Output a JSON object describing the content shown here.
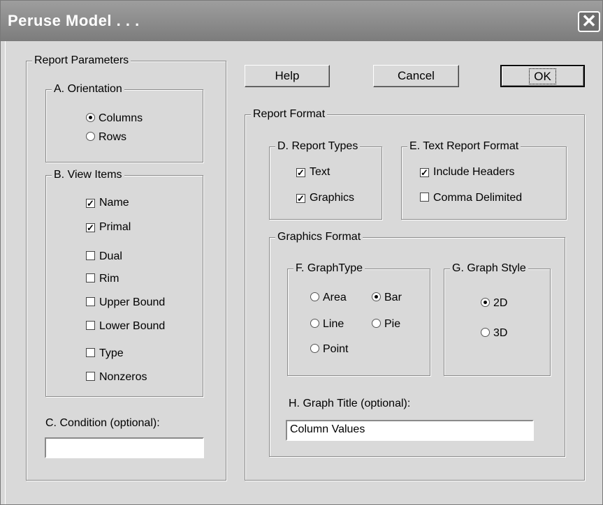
{
  "window": {
    "title": "Peruse Model . . .",
    "close_label": "✕"
  },
  "buttons": {
    "help": "Help",
    "cancel": "Cancel",
    "ok": "OK"
  },
  "report_parameters": {
    "legend": "Report Parameters",
    "orientation": {
      "legend": "A. Orientation",
      "columns": "Columns",
      "rows": "Rows",
      "selected": "Columns"
    },
    "view_items": {
      "legend": "B. View Items",
      "items": [
        {
          "label": "Name",
          "checked": true
        },
        {
          "label": "Primal",
          "checked": true
        },
        {
          "label": "Dual",
          "checked": false
        },
        {
          "label": "Rim",
          "checked": false
        },
        {
          "label": "Upper Bound",
          "checked": false
        },
        {
          "label": "Lower Bound",
          "checked": false
        },
        {
          "label": "Type",
          "checked": false
        },
        {
          "label": "Nonzeros",
          "checked": false
        }
      ]
    },
    "condition": {
      "label": "C. Condition (optional):",
      "value": ""
    }
  },
  "report_format": {
    "legend": "Report Format",
    "report_types": {
      "legend": "D. Report Types",
      "text": "Text",
      "graphics": "Graphics"
    },
    "text_report_format": {
      "legend": "E. Text Report Format",
      "include_headers": "Include Headers",
      "comma_delimited": "Comma Delimited"
    },
    "graphics_format": {
      "legend": "Graphics Format",
      "graph_type": {
        "legend": "F. GraphType",
        "area": "Area",
        "bar": "Bar",
        "line": "Line",
        "pie": "Pie",
        "point": "Point",
        "selected": "Bar"
      },
      "graph_style": {
        "legend": "G. Graph Style",
        "d2": "2D",
        "d3": "3D",
        "selected": "2D"
      },
      "graph_title": {
        "label": "H. Graph Title (optional):",
        "value": "Column Values"
      }
    }
  }
}
